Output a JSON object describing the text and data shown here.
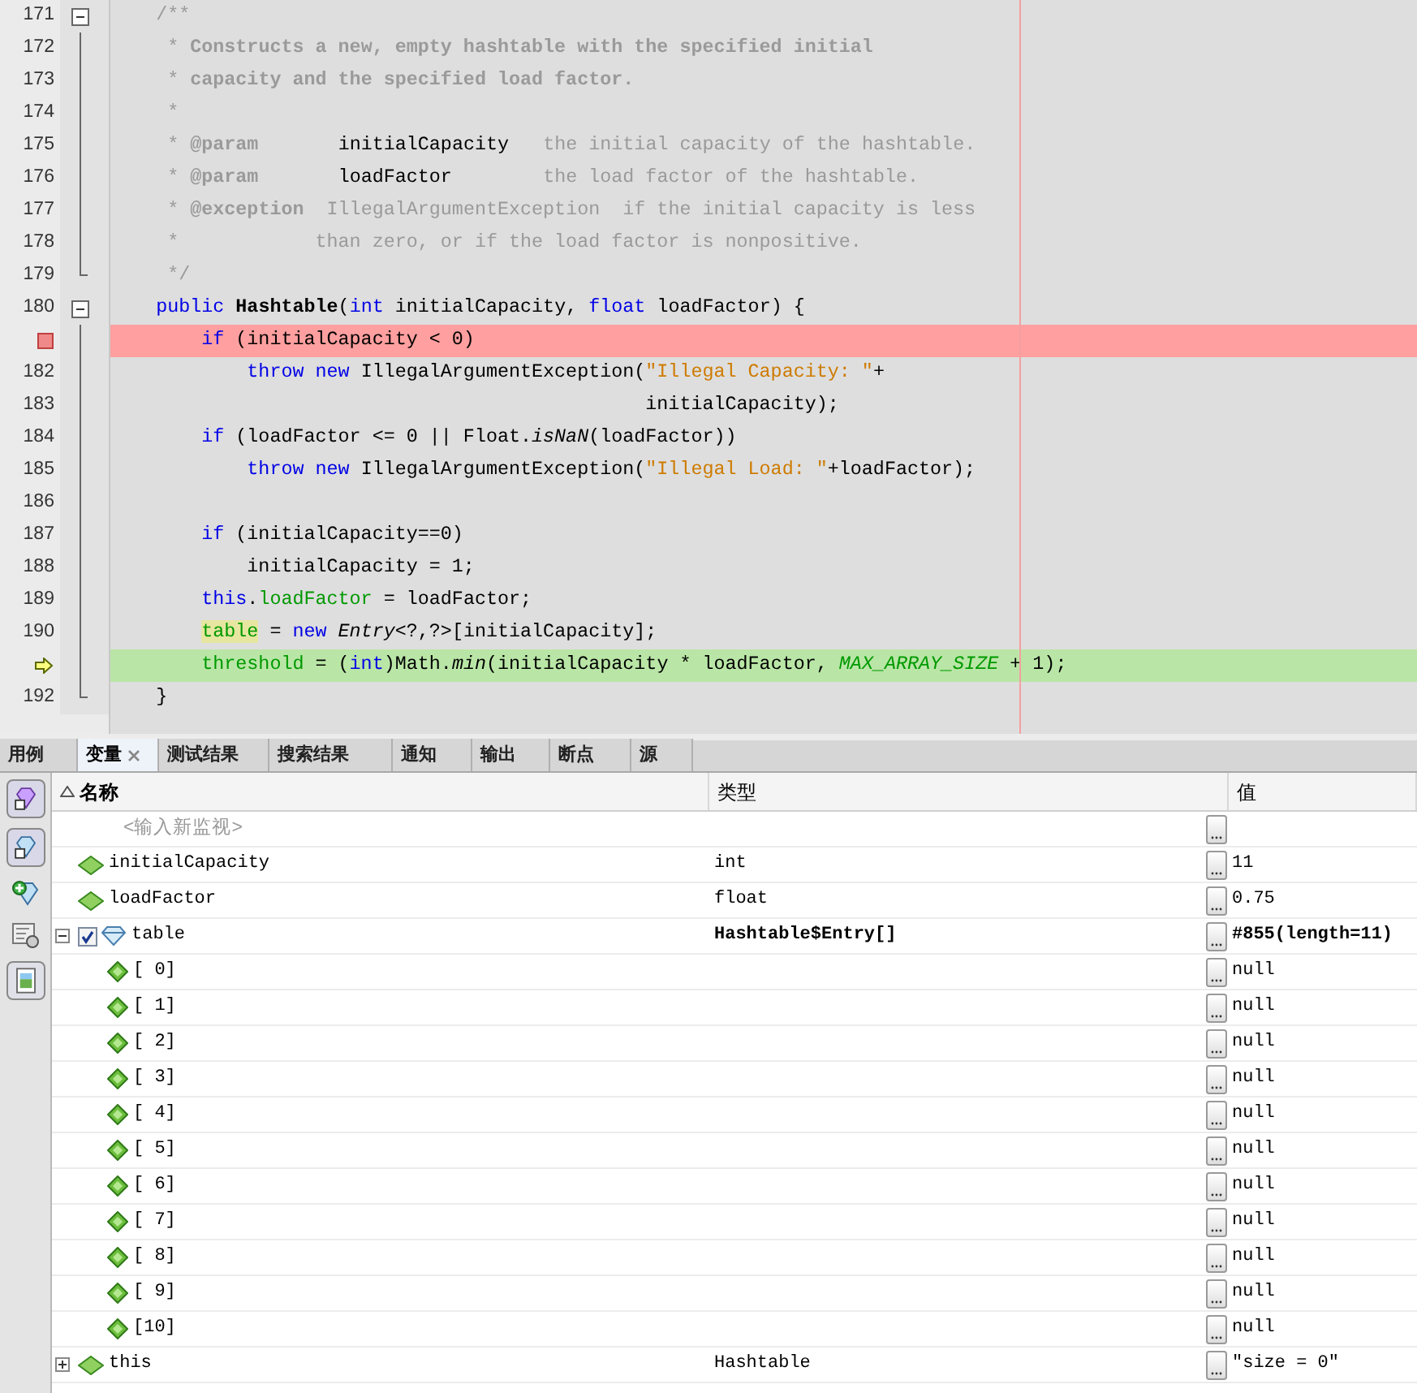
{
  "editor": {
    "lines": [
      {
        "number": "171",
        "kind": "normal",
        "foldable": true,
        "tokens": [
          {
            "kind": "comment",
            "text": "    /**"
          }
        ]
      },
      {
        "number": "172",
        "kind": "normal",
        "foldable": false,
        "tokens": [
          {
            "kind": "comment",
            "text": "     * "
          },
          {
            "kind": "comment_bold",
            "text": "Constructs a new, empty hashtable with the specified initial"
          }
        ]
      },
      {
        "number": "173",
        "kind": "normal",
        "foldable": false,
        "tokens": [
          {
            "kind": "comment",
            "text": "     * "
          },
          {
            "kind": "comment_bold",
            "text": "capacity and the specified load factor."
          }
        ]
      },
      {
        "number": "174",
        "kind": "normal",
        "foldable": false,
        "tokens": [
          {
            "kind": "comment",
            "text": "     *"
          }
        ]
      },
      {
        "number": "175",
        "kind": "normal",
        "foldable": false,
        "tokens": [
          {
            "kind": "comment",
            "text": "     * "
          },
          {
            "kind": "comment_bold",
            "text": "@param"
          },
          {
            "kind": "plain",
            "text": "       initialCapacity"
          },
          {
            "kind": "comment",
            "text": "   the initial capacity of the hashtable."
          }
        ]
      },
      {
        "number": "176",
        "kind": "normal",
        "foldable": false,
        "tokens": [
          {
            "kind": "comment",
            "text": "     * "
          },
          {
            "kind": "comment_bold",
            "text": "@param"
          },
          {
            "kind": "plain",
            "text": "       loadFactor"
          },
          {
            "kind": "comment",
            "text": "        the load factor of the hashtable."
          }
        ]
      },
      {
        "number": "177",
        "kind": "normal",
        "foldable": false,
        "tokens": [
          {
            "kind": "comment",
            "text": "     * "
          },
          {
            "kind": "comment_bold",
            "text": "@exception"
          },
          {
            "kind": "comment",
            "text": "  IllegalArgumentException  if the initial capacity is less"
          }
        ]
      },
      {
        "number": "178",
        "kind": "normal",
        "foldable": false,
        "tokens": [
          {
            "kind": "comment",
            "text": "     *            than zero, or if the load factor is nonpositive."
          }
        ]
      },
      {
        "number": "179",
        "kind": "normal",
        "foldable": false,
        "tokens": [
          {
            "kind": "comment",
            "text": "     */"
          }
        ]
      },
      {
        "number": "180",
        "kind": "normal",
        "foldable": true,
        "tokens": [
          {
            "kind": "keyword",
            "text": "    public "
          },
          {
            "kind": "bold",
            "text": "Hashtable"
          },
          {
            "kind": "plain",
            "text": "("
          },
          {
            "kind": "keyword",
            "text": "int"
          },
          {
            "kind": "plain",
            "text": " initialCapacity, "
          },
          {
            "kind": "keyword",
            "text": "float"
          },
          {
            "kind": "plain",
            "text": " loadFactor) {"
          }
        ]
      },
      {
        "kind": "breakpoint",
        "foldable": false,
        "tokens": [
          {
            "kind": "keyword",
            "text": "        if"
          },
          {
            "kind": "plain",
            "text": " (initialCapacity < 0)"
          }
        ]
      },
      {
        "number": "182",
        "kind": "normal",
        "foldable": false,
        "tokens": [
          {
            "kind": "keyword",
            "text": "            throw new"
          },
          {
            "kind": "plain",
            "text": " IllegalArgumentException("
          },
          {
            "kind": "string",
            "text": "\"Illegal Capacity: \""
          },
          {
            "kind": "plain",
            "text": "+"
          }
        ]
      },
      {
        "number": "183",
        "kind": "normal",
        "foldable": false,
        "tokens": [
          {
            "kind": "plain",
            "text": "                                               initialCapacity);"
          }
        ]
      },
      {
        "number": "184",
        "kind": "normal",
        "foldable": false,
        "tokens": [
          {
            "kind": "keyword",
            "text": "        if"
          },
          {
            "kind": "plain",
            "text": " (loadFactor <= 0 || Float."
          },
          {
            "kind": "italic",
            "text": "isNaN"
          },
          {
            "kind": "plain",
            "text": "(loadFactor))"
          }
        ]
      },
      {
        "number": "185",
        "kind": "normal",
        "foldable": false,
        "tokens": [
          {
            "kind": "keyword",
            "text": "            throw new"
          },
          {
            "kind": "plain",
            "text": " IllegalArgumentException("
          },
          {
            "kind": "string",
            "text": "\"Illegal Load: \""
          },
          {
            "kind": "plain",
            "text": "+loadFactor);"
          }
        ]
      },
      {
        "number": "186",
        "kind": "normal",
        "foldable": false
      },
      {
        "number": "187",
        "kind": "normal",
        "foldable": false,
        "tokens": [
          {
            "kind": "keyword",
            "text": "        if"
          },
          {
            "kind": "plain",
            "text": " (initialCapacity==0)"
          }
        ]
      },
      {
        "number": "188",
        "kind": "normal",
        "foldable": false,
        "tokens": [
          {
            "kind": "plain",
            "text": "            initialCapacity = 1;"
          }
        ]
      },
      {
        "number": "189",
        "kind": "normal",
        "foldable": false,
        "tokens": [
          {
            "kind": "keyword",
            "text": "        this"
          },
          {
            "kind": "plain",
            "text": "."
          },
          {
            "kind": "field",
            "text": "loadFactor"
          },
          {
            "kind": "plain",
            "text": " = loadFactor;"
          }
        ]
      },
      {
        "number": "190",
        "kind": "normal",
        "foldable": false,
        "tokens": [
          {
            "kind": "field_marked",
            "text": "        table"
          },
          {
            "kind": "plain",
            "text": " = "
          },
          {
            "kind": "keyword",
            "text": "new "
          },
          {
            "kind": "italic",
            "text": "Entry"
          },
          {
            "kind": "plain",
            "text": "<?,?>[initialCapacity];"
          }
        ]
      },
      {
        "kind": "current",
        "foldable": false,
        "tokens": [
          {
            "kind": "field",
            "text": "        threshold"
          },
          {
            "kind": "plain",
            "text": " = ("
          },
          {
            "kind": "keyword",
            "text": "int"
          },
          {
            "kind": "plain",
            "text": ")Math."
          },
          {
            "kind": "italic",
            "text": "min"
          },
          {
            "kind": "plain",
            "text": "(initialCapacity * loadFactor, "
          },
          {
            "kind": "static",
            "text": "MAX_ARRAY_SIZE"
          },
          {
            "kind": "plain",
            "text": " + 1);"
          }
        ]
      },
      {
        "number": "192",
        "kind": "normal",
        "foldable": false,
        "tokens": [
          {
            "kind": "plain",
            "text": "    }"
          }
        ]
      }
    ]
  },
  "bottom_tabs": [
    {
      "label": "用例",
      "selected": false
    },
    {
      "label": "变量",
      "selected": true,
      "closable": true
    },
    {
      "label": "测试结果",
      "selected": false
    },
    {
      "label": "搜索结果",
      "selected": false
    },
    {
      "label": "通知",
      "selected": false
    },
    {
      "label": "输出",
      "selected": false
    },
    {
      "label": "断点",
      "selected": false
    },
    {
      "label": "源",
      "selected": false
    }
  ],
  "variables": {
    "columns": [
      "名称",
      "类型",
      "值"
    ],
    "new_watch": {
      "placeholder": "<输入新监视>"
    },
    "rows": [
      {
        "name": "initialCapacity",
        "type": "int",
        "value": "11",
        "kind": "local"
      },
      {
        "name": "loadFactor",
        "type": "float",
        "value": "0.75",
        "kind": "local"
      },
      {
        "name": "table",
        "type": "Hashtable$Entry[]",
        "value": "#855(length=11)",
        "kind": "array",
        "expanded": true,
        "checked": true,
        "children": [
          {
            "name": "[ 0]",
            "value": "null",
            "kind": "element"
          },
          {
            "name": "[ 1]",
            "value": "null",
            "kind": "element"
          },
          {
            "name": "[ 2]",
            "value": "null",
            "kind": "element"
          },
          {
            "name": "[ 3]",
            "value": "null",
            "kind": "element"
          },
          {
            "name": "[ 4]",
            "value": "null",
            "kind": "element"
          },
          {
            "name": "[ 5]",
            "value": "null",
            "kind": "element"
          },
          {
            "name": "[ 6]",
            "value": "null",
            "kind": "element"
          },
          {
            "name": "[ 7]",
            "value": "null",
            "kind": "element"
          },
          {
            "name": "[ 8]",
            "value": "null",
            "kind": "element"
          },
          {
            "name": "[ 9]",
            "value": "null",
            "kind": "element"
          },
          {
            "name": "[10]",
            "value": "null",
            "kind": "element"
          }
        ]
      },
      {
        "name": "this",
        "type": "Hashtable",
        "value": "\"size = 0\"",
        "kind": "local",
        "expanded": false
      }
    ]
  }
}
